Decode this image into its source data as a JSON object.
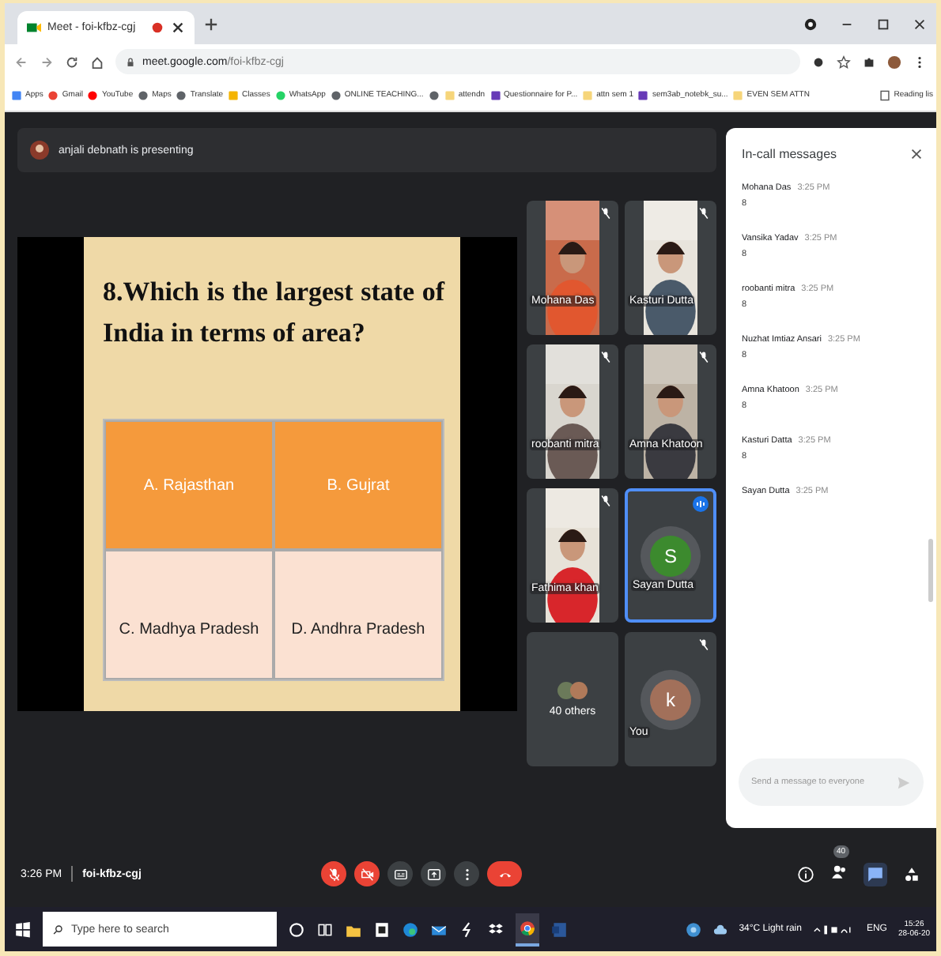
{
  "browser": {
    "tab_title": "Meet - foi-kfbz-cgj",
    "url_host": "meet.google.com",
    "url_path": "/foi-kfbz-cgj",
    "bookmarks": [
      {
        "kind": "apps",
        "label": "Apps"
      },
      {
        "kind": "gmail",
        "label": "Gmail"
      },
      {
        "kind": "youtube",
        "label": "YouTube"
      },
      {
        "kind": "globe",
        "label": "Maps"
      },
      {
        "kind": "globe",
        "label": "Translate"
      },
      {
        "kind": "classroom",
        "label": "Classes"
      },
      {
        "kind": "whatsapp",
        "label": "WhatsApp"
      },
      {
        "kind": "globe",
        "label": "ONLINE TEACHING..."
      },
      {
        "kind": "globe"
      },
      {
        "kind": "folder",
        "label": "attendn"
      },
      {
        "kind": "form",
        "label": "Questionnaire for P..."
      },
      {
        "kind": "folder",
        "label": "attn sem 1"
      },
      {
        "kind": "form",
        "label": "sem3ab_notebk_su..."
      },
      {
        "kind": "folder",
        "label": "EVEN SEM ATTN"
      }
    ],
    "reading_list": "Reading lis"
  },
  "presenter": "anjali debnath is presenting",
  "slide": {
    "question": "8.Which is the largest state of India in terms of area?",
    "options": [
      {
        "label": "A. Rajasthan",
        "kind": "header"
      },
      {
        "label": "B. Gujrat",
        "kind": "header"
      },
      {
        "label": "C. Madhya Pradesh",
        "kind": "body"
      },
      {
        "label": "D. Andhra Pradesh",
        "kind": "body"
      }
    ]
  },
  "tiles": [
    {
      "kind": "video",
      "name": "Mohana Das",
      "muted": true,
      "speaking": false
    },
    {
      "kind": "video",
      "name": "Kasturi Dutta",
      "muted": true,
      "speaking": false
    },
    {
      "kind": "video",
      "name": "roobanti mitra",
      "muted": true,
      "speaking": false
    },
    {
      "kind": "video",
      "name": "Amna Khatoon",
      "muted": true,
      "speaking": false
    },
    {
      "kind": "video",
      "name": "Fathima khan",
      "muted": true,
      "speaking": false
    },
    {
      "kind": "avatar",
      "name": "Sayan Dutta",
      "initial": "S",
      "color": "#3c8a2e",
      "muted": false,
      "speaking": true
    },
    {
      "kind": "others",
      "name": "40 others",
      "muted": false,
      "speaking": false
    },
    {
      "kind": "avatar",
      "name": "You",
      "initial": "k",
      "color": "#a2705a",
      "muted": true,
      "speaking": false
    }
  ],
  "chat": {
    "title": "In-call messages",
    "placeholder": "Send a message to everyone",
    "messages": [
      {
        "sender": "Mohana Das",
        "time": "3:25 PM",
        "text": "8"
      },
      {
        "sender": "Vansika Yadav",
        "time": "3:25 PM",
        "text": "8"
      },
      {
        "sender": "roobanti mitra",
        "time": "3:25 PM",
        "text": "8"
      },
      {
        "sender": "Nuzhat Imtiaz Ansari",
        "time": "3:25 PM",
        "text": "8"
      },
      {
        "sender": "Amna Khatoon",
        "time": "3:25 PM",
        "text": "8"
      },
      {
        "sender": "Kasturi Datta",
        "time": "3:25 PM",
        "text": "8"
      },
      {
        "sender": "Sayan Dutta",
        "time": "3:25 PM"
      }
    ]
  },
  "bottom": {
    "time": "3:26 PM",
    "code": "foi-kfbz-cgj",
    "participants": "40",
    "controls": [
      {
        "kind": "mic",
        "on": false
      },
      {
        "kind": "camera",
        "on": false
      },
      {
        "kind": "captions"
      },
      {
        "kind": "present"
      },
      {
        "kind": "more"
      },
      {
        "kind": "hangup"
      }
    ],
    "chat_selected": true
  },
  "taskbar": {
    "search_placeholder": "Type here to search",
    "weather": "34°C  Light rain",
    "lang": "ENG",
    "time": "15:26",
    "date": "28-06-20"
  }
}
